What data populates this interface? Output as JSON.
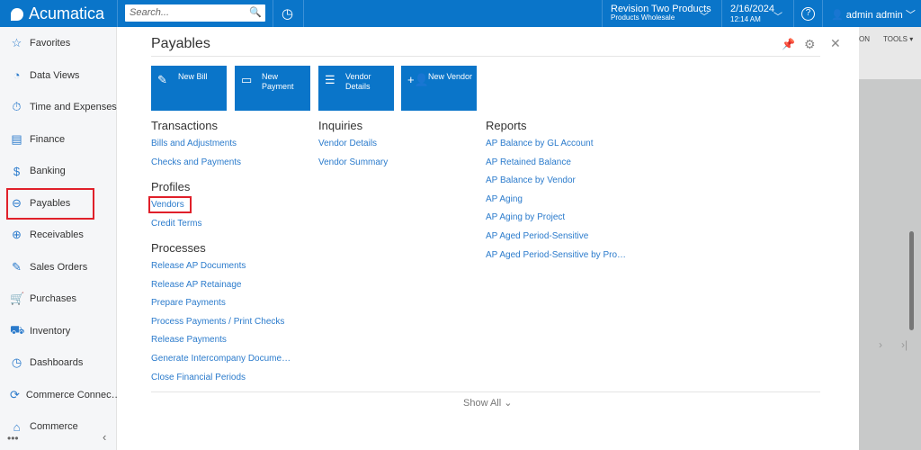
{
  "header": {
    "logo": "Acumatica",
    "search_placeholder": "Search...",
    "company": "Revision Two Products",
    "branch": "Products Wholesale",
    "date": "2/16/2024",
    "time": "12:14 AM",
    "user": "admin admin"
  },
  "sidebar": {
    "items": [
      {
        "label": "Favorites",
        "icon": "☆"
      },
      {
        "label": "Data Views",
        "icon": "◔"
      },
      {
        "label": "Time and Expenses",
        "icon": "⏱"
      },
      {
        "label": "Finance",
        "icon": "▤"
      },
      {
        "label": "Banking",
        "icon": "$"
      },
      {
        "label": "Payables",
        "icon": "⊖"
      },
      {
        "label": "Receivables",
        "icon": "⊕"
      },
      {
        "label": "Sales Orders",
        "icon": "✎"
      },
      {
        "label": "Purchases",
        "icon": "🛒"
      },
      {
        "label": "Inventory",
        "icon": "⛟"
      },
      {
        "label": "Dashboards",
        "icon": "◷"
      },
      {
        "label": "Commerce Connec…",
        "icon": "⟳"
      },
      {
        "label": "Commerce",
        "icon": "⌂"
      }
    ],
    "more": "•••",
    "collapse": "‹"
  },
  "background": {
    "tab_partial": "ON",
    "tools": "TOOLS ▾"
  },
  "panel": {
    "title": "Payables",
    "tiles": [
      {
        "label": "New Bill",
        "icon": "✎"
      },
      {
        "label": "New Payment",
        "icon": "▭"
      },
      {
        "label": "Vendor Details",
        "icon": "☰"
      },
      {
        "label": "New Vendor",
        "icon": "+👤"
      }
    ],
    "transactions": {
      "title": "Transactions",
      "links": [
        "Bills and Adjustments",
        "Checks and Payments"
      ]
    },
    "profiles": {
      "title": "Profiles",
      "links": [
        "Vendors",
        "Credit Terms"
      ]
    },
    "processes": {
      "title": "Processes",
      "links": [
        "Release AP Documents",
        "Release AP Retainage",
        "Prepare Payments",
        "Process Payments / Print Checks",
        "Release Payments",
        "Generate Intercompany Docume…",
        "Close Financial Periods"
      ]
    },
    "inquiries": {
      "title": "Inquiries",
      "links": [
        "Vendor Details",
        "Vendor Summary"
      ]
    },
    "reports": {
      "title": "Reports",
      "links": [
        "AP Balance by GL Account",
        "AP Retained Balance",
        "AP Balance by Vendor",
        "AP Aging",
        "AP Aging by Project",
        "AP Aged Period-Sensitive",
        "AP Aged Period-Sensitive by Pro…"
      ]
    },
    "show_all": "Show All ⌄"
  },
  "colors": {
    "brand": "#0a75c9",
    "link": "#2b7bcc",
    "highlight": "#e0202a"
  }
}
